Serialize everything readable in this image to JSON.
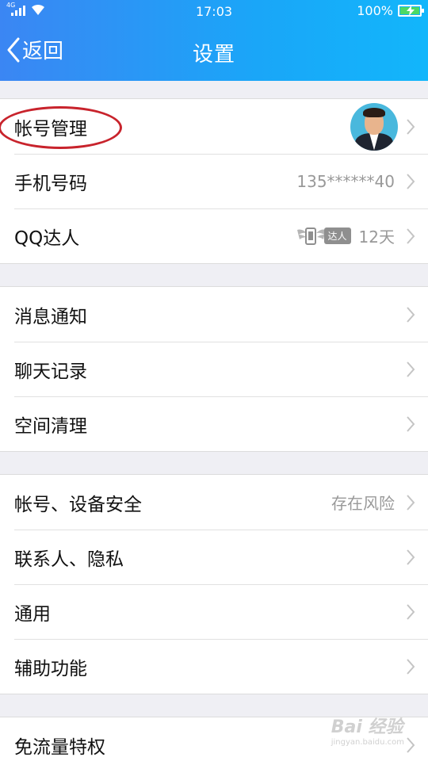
{
  "status_bar": {
    "signal_label": "4G",
    "time": "17:03",
    "battery": "100%"
  },
  "navbar": {
    "back_label": "返回",
    "title": "设置"
  },
  "groups": [
    [
      {
        "label": "帐号管理",
        "value": "",
        "extra": "avatar"
      },
      {
        "label": "手机号码",
        "value": "135******40"
      },
      {
        "label": "QQ达人",
        "value": "12天",
        "badge": "达人"
      }
    ],
    [
      {
        "label": "消息通知",
        "value": ""
      },
      {
        "label": "聊天记录",
        "value": ""
      },
      {
        "label": "空间清理",
        "value": ""
      }
    ],
    [
      {
        "label": "帐号、设备安全",
        "value": "存在风险"
      },
      {
        "label": "联系人、隐私",
        "value": ""
      },
      {
        "label": "通用",
        "value": ""
      },
      {
        "label": "辅助功能",
        "value": ""
      }
    ],
    [
      {
        "label": "免流量特权",
        "value": ""
      }
    ]
  ],
  "colors": {
    "header_start": "#3b86f3",
    "header_end": "#12b6fb",
    "annotation": "#c8232c"
  },
  "watermark": {
    "logo": "Bai 经验",
    "url": "jingyan.baidu.com"
  }
}
